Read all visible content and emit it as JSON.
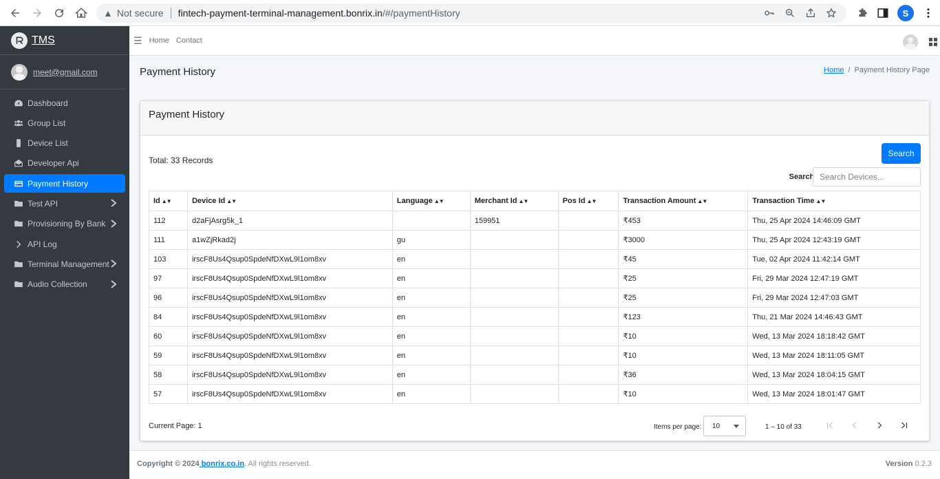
{
  "browser": {
    "security_label": "Not secure",
    "url_host": "fintech-payment-terminal-management.bonrix.in",
    "url_path": "/#/paymentHistory",
    "profile_initial": "S"
  },
  "sidebar": {
    "brand": "TMS",
    "user_email": "meet@gmail.com",
    "items": [
      {
        "label": "Dashboard",
        "icon": "dashboard-icon",
        "has_arrow": false
      },
      {
        "label": "Group List",
        "icon": "users-icon",
        "has_arrow": false
      },
      {
        "label": "Device List",
        "icon": "mobile-icon",
        "has_arrow": false
      },
      {
        "label": "Developer Api",
        "icon": "envelope-icon",
        "has_arrow": false
      },
      {
        "label": "Payment History",
        "icon": "credit-card-icon",
        "has_arrow": false,
        "active": true
      },
      {
        "label": "Test API",
        "icon": "folder-icon",
        "has_arrow": true
      },
      {
        "label": "Provisioning By Bank",
        "icon": "folder-icon",
        "has_arrow": true
      },
      {
        "label": "API Log",
        "icon": "chevron-right-icon",
        "has_arrow": false
      },
      {
        "label": "Terminal Management",
        "icon": "folder-icon",
        "has_arrow": true
      },
      {
        "label": "Audio Collection",
        "icon": "folder-icon",
        "has_arrow": true
      }
    ]
  },
  "topnav": {
    "home": "Home",
    "contact": "Contact"
  },
  "page": {
    "title": "Payment History",
    "breadcrumb_home": "Home",
    "breadcrumb_current": "Payment History Page",
    "card_title": "Payment History",
    "total": "Total: 33 Records",
    "search_button": "Search",
    "search_label": "Search:",
    "search_placeholder": "Search Devices..."
  },
  "table": {
    "columns": [
      "Id",
      "Device Id",
      "Language",
      "Merchant Id",
      "Pos Id",
      "Transaction Amount",
      "Transaction Time"
    ],
    "rows": [
      [
        "112",
        "d2aFjAsrg5k_1",
        "",
        "159951",
        "",
        "₹453",
        "Thu, 25 Apr 2024 14:46:09 GMT"
      ],
      [
        "111",
        "a1wZjRkad2j",
        "gu",
        "",
        "",
        "₹3000",
        "Thu, 25 Apr 2024 12:43:19 GMT"
      ],
      [
        "103",
        "irscF8Us4Qsup0SpdeNfDXwL9l1om8xv",
        "en",
        "",
        "",
        "₹45",
        "Tue, 02 Apr 2024 11:42:14 GMT"
      ],
      [
        "97",
        "irscF8Us4Qsup0SpdeNfDXwL9l1om8xv",
        "en",
        "",
        "",
        "₹25",
        "Fri, 29 Mar 2024 12:47:19 GMT"
      ],
      [
        "96",
        "irscF8Us4Qsup0SpdeNfDXwL9l1om8xv",
        "en",
        "",
        "",
        "₹25",
        "Fri, 29 Mar 2024 12:47:03 GMT"
      ],
      [
        "84",
        "irscF8Us4Qsup0SpdeNfDXwL9l1om8xv",
        "en",
        "",
        "",
        "₹123",
        "Thu, 21 Mar 2024 14:46:43 GMT"
      ],
      [
        "60",
        "irscF8Us4Qsup0SpdeNfDXwL9l1om8xv",
        "en",
        "",
        "",
        "₹10",
        "Wed, 13 Mar 2024 18:18:42 GMT"
      ],
      [
        "59",
        "irscF8Us4Qsup0SpdeNfDXwL9l1om8xv",
        "en",
        "",
        "",
        "₹10",
        "Wed, 13 Mar 2024 18:11:05 GMT"
      ],
      [
        "58",
        "irscF8Us4Qsup0SpdeNfDXwL9l1om8xv",
        "en",
        "",
        "",
        "₹36",
        "Wed, 13 Mar 2024 18:04:15 GMT"
      ],
      [
        "57",
        "irscF8Us4Qsup0SpdeNfDXwL9l1om8xv",
        "en",
        "",
        "",
        "₹10",
        "Wed, 13 Mar 2024 18:01:47 GMT"
      ]
    ]
  },
  "pagination": {
    "current_page": "Current Page: 1",
    "items_per_page_label": "Items per page:",
    "items_per_page_value": "10",
    "range": "1 – 10 of 33"
  },
  "footer": {
    "copyright_prefix": "Copyright © 2024",
    "link": " bonrix.co.in",
    "suffix": ". All rights reserved.",
    "version_label": "Version",
    "version_value": " 0.2.3"
  },
  "colors": {
    "sidebar_bg": "#343a40",
    "accent": "#007bff"
  }
}
